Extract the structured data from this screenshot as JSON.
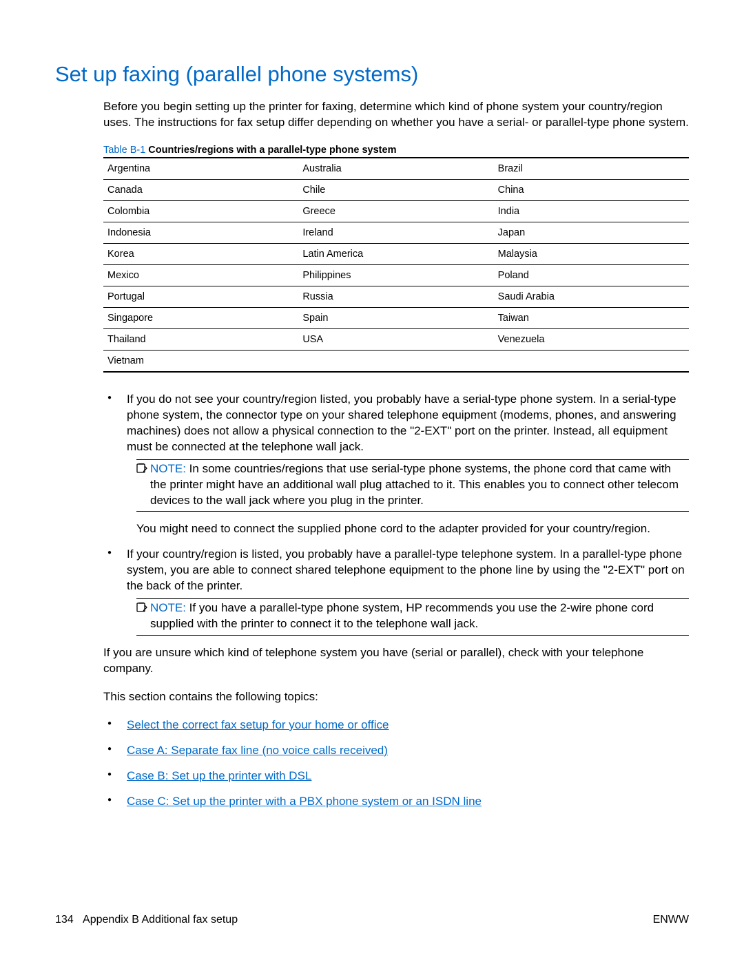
{
  "title": "Set up faxing (parallel phone systems)",
  "intro": "Before you begin setting up the printer for faxing, determine which kind of phone system your country/region uses. The instructions for fax setup differ depending on whether you have a serial- or parallel-type phone system.",
  "table": {
    "caption_prefix": "Table B-1",
    "caption_title": "  Countries/regions with a parallel-type phone system",
    "rows": [
      [
        "Argentina",
        "Australia",
        "Brazil"
      ],
      [
        "Canada",
        "Chile",
        "China"
      ],
      [
        "Colombia",
        "Greece",
        "India"
      ],
      [
        "Indonesia",
        "Ireland",
        "Japan"
      ],
      [
        "Korea",
        "Latin America",
        "Malaysia"
      ],
      [
        "Mexico",
        "Philippines",
        "Poland"
      ],
      [
        "Portugal",
        "Russia",
        "Saudi Arabia"
      ],
      [
        "Singapore",
        "Spain",
        "Taiwan"
      ],
      [
        "Thailand",
        "USA",
        "Venezuela"
      ],
      [
        "Vietnam",
        "",
        ""
      ]
    ]
  },
  "bullet1": "If you do not see your country/region listed, you probably have a serial-type phone system. In a serial-type phone system, the connector type on your shared telephone equipment (modems, phones, and answering machines) does not allow a physical connection to the \"2-EXT\" port on the printer. Instead, all equipment must be connected at the telephone wall jack.",
  "note1_label": "NOTE:",
  "note1_text": "   In some countries/regions that use serial-type phone systems, the phone cord that came with the printer might have an additional wall plug attached to it. This enables you to connect other telecom devices to the wall jack where you plug in the printer.",
  "extra1": "You might need to connect the supplied phone cord to the adapter provided for your country/region.",
  "bullet2": "If your country/region is listed, you probably have a parallel-type telephone system. In a parallel-type phone system, you are able to connect shared telephone equipment to the phone line by using the \"2-EXT\" port on the back of the printer.",
  "note2_label": "NOTE:",
  "note2_text": "   If you have a parallel-type phone system, HP recommends you use the 2-wire phone cord supplied with the printer to connect it to the telephone wall jack.",
  "unsure": "If you are unsure which kind of telephone system you have (serial or parallel), check with your telephone company.",
  "topics_intro": "This section contains the following topics:",
  "topics": [
    "Select the correct fax setup for your home or office",
    "Case A: Separate fax line (no voice calls received)",
    "Case B: Set up the printer with DSL",
    "Case C: Set up the printer with a PBX phone system or an ISDN line"
  ],
  "footer": {
    "page": "134",
    "appendix": "Appendix B   Additional fax setup",
    "right": "ENWW"
  }
}
